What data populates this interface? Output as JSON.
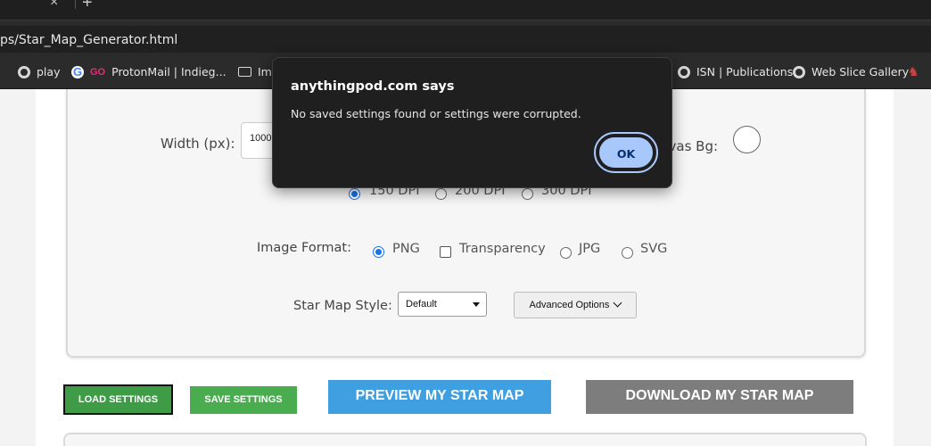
{
  "browser": {
    "url": "ps/Star_Map_Generator.html",
    "bookmarks": [
      "play",
      "ProtonMail | Indieg...",
      "Im",
      "ISN | Publications",
      "Web Slice Gallery"
    ]
  },
  "form": {
    "width_label": "Width (px):",
    "width_value": "1000",
    "canvas_bg_label": "nvas Bg:",
    "dpi_options": [
      "150 DPI",
      "200 DPI",
      "300 DPI"
    ],
    "dpi_selected": "150 DPI",
    "format_label": "Image Format:",
    "format_png": "PNG",
    "format_transparency": "Transparency",
    "format_jpg": "JPG",
    "format_svg": "SVG",
    "style_label": "Star Map Style:",
    "style_value": "Default",
    "advanced_label": "Advanced Options"
  },
  "buttons": {
    "load": "LOAD SETTINGS",
    "save": "SAVE SETTINGS",
    "preview": "PREVIEW MY STAR MAP",
    "download": "DOWNLOAD MY STAR MAP"
  },
  "dialog": {
    "title": "anythingpod.com says",
    "message": "No saved settings found or settings were corrupted.",
    "ok": "OK"
  },
  "colors": {
    "load_button": "#3f9c46",
    "save_button": "#49ad4f",
    "preview_button": "#3f9fe0",
    "download_button": "#7d7d7d",
    "dialog_ok": "#a8c7fa"
  }
}
